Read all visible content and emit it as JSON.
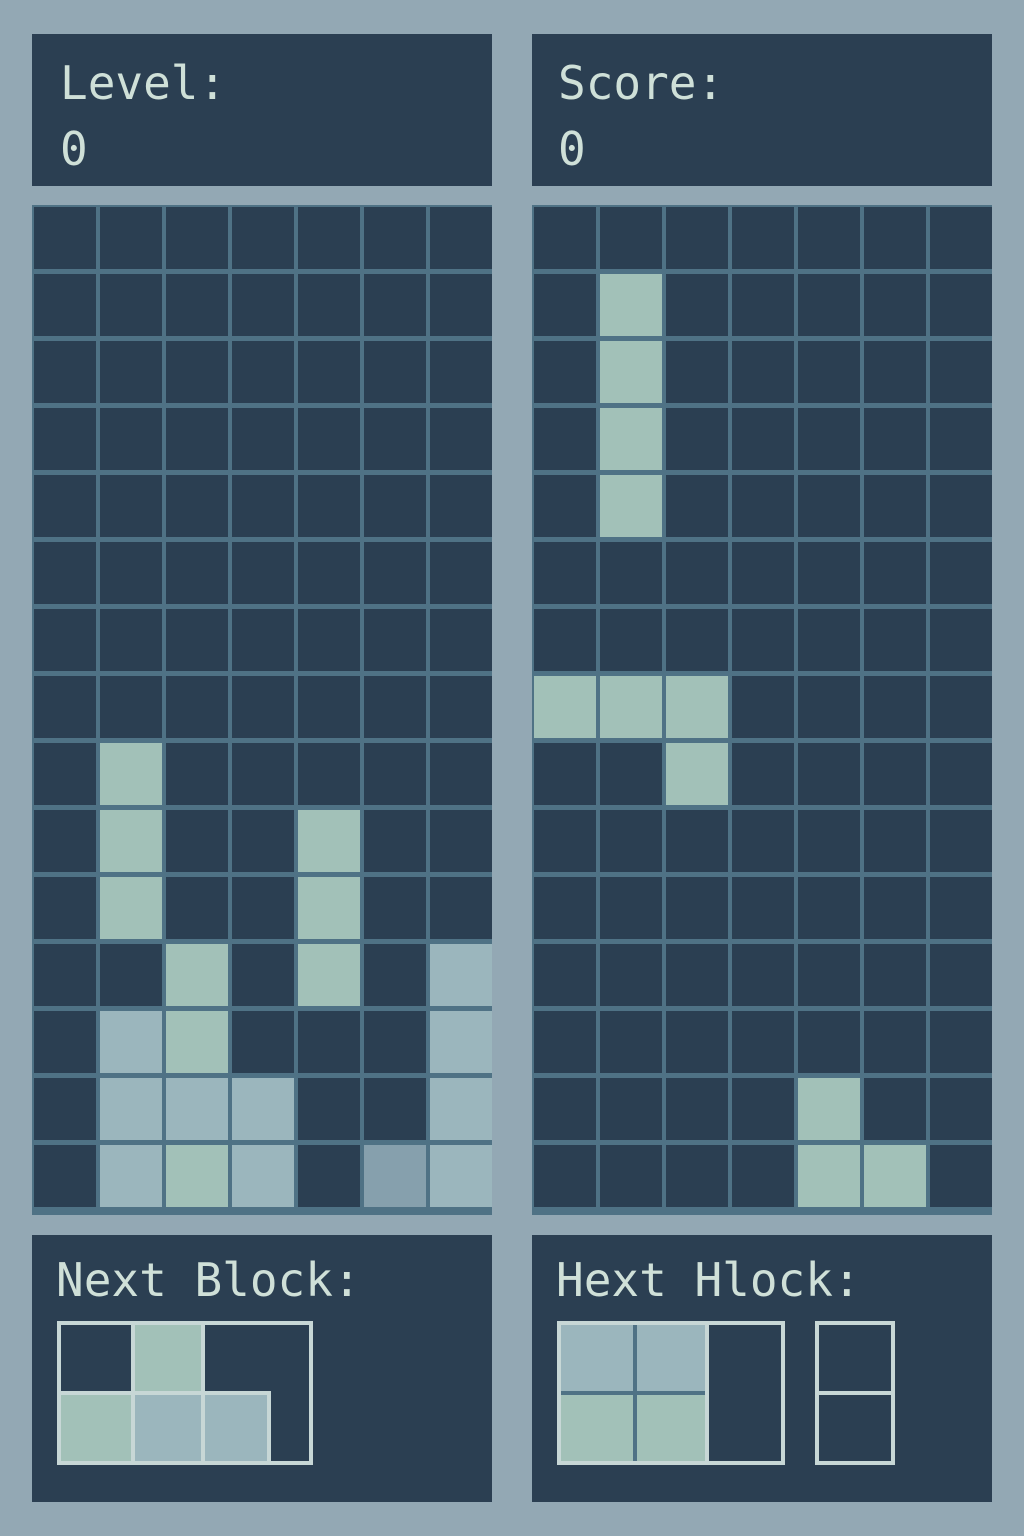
{
  "left_panel": {
    "level_label": "Level:",
    "level_value": "0",
    "next_label": "Next Block:"
  },
  "right_panel": {
    "score_label": "Score:",
    "score_value": "0",
    "next_label": "Hext Hlock:"
  },
  "colors": {
    "background": "#93a8b4",
    "panel": "#2b3f52",
    "grid_line": "#4f7285",
    "block": "#a2c1b8",
    "block_alt": "#9bb6bd",
    "block_dim": "#86a0ad",
    "text": "#cfe0d8"
  },
  "board_columns": 7,
  "board_rows": 15,
  "left_board": [
    [
      0,
      0,
      0,
      0,
      0,
      0,
      0
    ],
    [
      0,
      0,
      0,
      0,
      0,
      0,
      0
    ],
    [
      0,
      0,
      0,
      0,
      0,
      0,
      0
    ],
    [
      0,
      0,
      0,
      0,
      0,
      0,
      0
    ],
    [
      0,
      0,
      0,
      0,
      0,
      0,
      0
    ],
    [
      0,
      0,
      0,
      0,
      0,
      0,
      0
    ],
    [
      0,
      0,
      0,
      0,
      0,
      0,
      0
    ],
    [
      0,
      0,
      0,
      0,
      0,
      0,
      0
    ],
    [
      0,
      1,
      0,
      0,
      0,
      0,
      0
    ],
    [
      0,
      1,
      0,
      0,
      1,
      0,
      0
    ],
    [
      0,
      1,
      0,
      0,
      1,
      0,
      0
    ],
    [
      0,
      0,
      1,
      0,
      1,
      0,
      2
    ],
    [
      0,
      2,
      1,
      0,
      0,
      0,
      2
    ],
    [
      0,
      2,
      2,
      2,
      0,
      0,
      2
    ],
    [
      0,
      2,
      1,
      2,
      0,
      3,
      2
    ]
  ],
  "right_board": [
    [
      0,
      0,
      0,
      0,
      0,
      0,
      0
    ],
    [
      0,
      1,
      0,
      0,
      0,
      0,
      0
    ],
    [
      0,
      1,
      0,
      0,
      0,
      0,
      0
    ],
    [
      0,
      1,
      0,
      0,
      0,
      0,
      0
    ],
    [
      0,
      1,
      0,
      0,
      0,
      0,
      0
    ],
    [
      0,
      0,
      0,
      0,
      0,
      0,
      0
    ],
    [
      0,
      0,
      0,
      0,
      0,
      0,
      0
    ],
    [
      1,
      1,
      1,
      0,
      0,
      0,
      0
    ],
    [
      0,
      0,
      1,
      0,
      0,
      0,
      0
    ],
    [
      0,
      0,
      0,
      0,
      0,
      0,
      0
    ],
    [
      0,
      0,
      0,
      0,
      0,
      0,
      0
    ],
    [
      0,
      0,
      0,
      0,
      0,
      0,
      0
    ],
    [
      0,
      0,
      0,
      0,
      0,
      0,
      0
    ],
    [
      0,
      0,
      0,
      0,
      1,
      0,
      0
    ],
    [
      0,
      0,
      0,
      0,
      1,
      1,
      0
    ]
  ]
}
